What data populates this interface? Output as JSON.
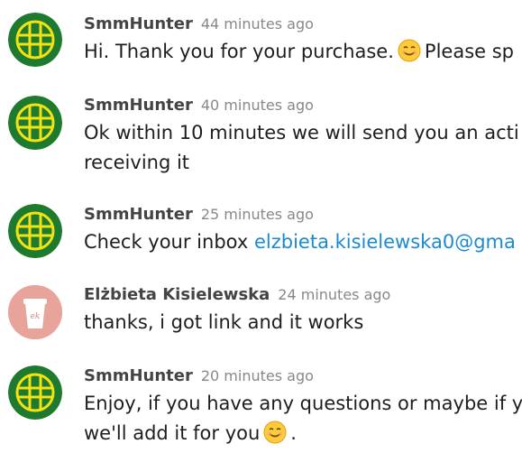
{
  "messages": [
    {
      "author": "SmmHunter",
      "time": "44 minutes ago",
      "lines": [
        "Hi. Thank you for your purchase.",
        "Please sp"
      ],
      "avatar": "smmhunter-logo"
    },
    {
      "author": "SmmHunter",
      "time": "40 minutes ago",
      "lines": [
        "Ok within 10 minutes we will send you an acti",
        "receiving it"
      ],
      "avatar": "smmhunter-logo"
    },
    {
      "author": "SmmHunter",
      "time": "25 minutes ago",
      "lines": [
        "Check your inbox",
        "elzbieta.kisielewska0@gma"
      ],
      "avatar": "smmhunter-logo"
    },
    {
      "author": "Elżbieta Kisielewska",
      "time": "24 minutes ago",
      "lines": [
        "thanks, i got link and it works"
      ],
      "avatar": "coffee-cup-avatar",
      "avatar_text": "ek"
    },
    {
      "author": "SmmHunter",
      "time": "20 minutes ago",
      "lines": [
        "Enjoy, if you have any questions or maybe if y",
        "we'll add it for you",
        "."
      ],
      "avatar": "smmhunter-logo"
    }
  ],
  "colors": {
    "logo_green": "#1d7a2e",
    "logo_yellow": "#f4e311",
    "link": "#1a8ad1",
    "avatar_pink": "#e8a49a"
  },
  "icons": [
    "smiling-face-emoji",
    "smmhunter-logo",
    "coffee-cup-avatar"
  ]
}
